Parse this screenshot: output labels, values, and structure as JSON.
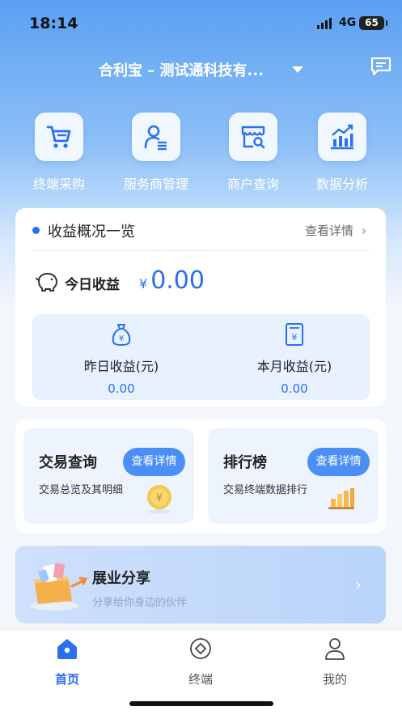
{
  "status_bar": {
    "time": "18:14",
    "network": "4G",
    "battery": "65"
  },
  "header": {
    "company": "合利宝 – 测试通科技有..."
  },
  "quick_actions": [
    {
      "label": "终端采购",
      "icon": "cart-icon"
    },
    {
      "label": "服务商管理",
      "icon": "provider-icon"
    },
    {
      "label": "商户查询",
      "icon": "store-search-icon"
    },
    {
      "label": "数据分析",
      "icon": "chart-icon"
    }
  ],
  "earnings": {
    "title": "收益概况一览",
    "more": "查看详情",
    "today_label": "今日收益",
    "currency": "¥",
    "today_value": "0.00",
    "yesterday_label": "昨日收益(元)",
    "yesterday_value": "0.00",
    "month_label": "本月收益(元)",
    "month_value": "0.00"
  },
  "cards": {
    "transactions": {
      "title": "交易查询",
      "subtitle": "交易总览及其明细",
      "button": "查看详情"
    },
    "ranking": {
      "title": "排行榜",
      "subtitle": "交易终端数据排行",
      "button": "查看详情"
    }
  },
  "banner": {
    "title": "展业分享",
    "subtitle": "分享给你身边的伙伴"
  },
  "tabbar": [
    {
      "label": "首页",
      "icon": "home-icon",
      "active": true
    },
    {
      "label": "终端",
      "icon": "terminal-icon",
      "active": false
    },
    {
      "label": "我的",
      "icon": "profile-icon",
      "active": false
    }
  ],
  "colors": {
    "accent": "#2a6ff0",
    "button": "#4a8ff5"
  }
}
